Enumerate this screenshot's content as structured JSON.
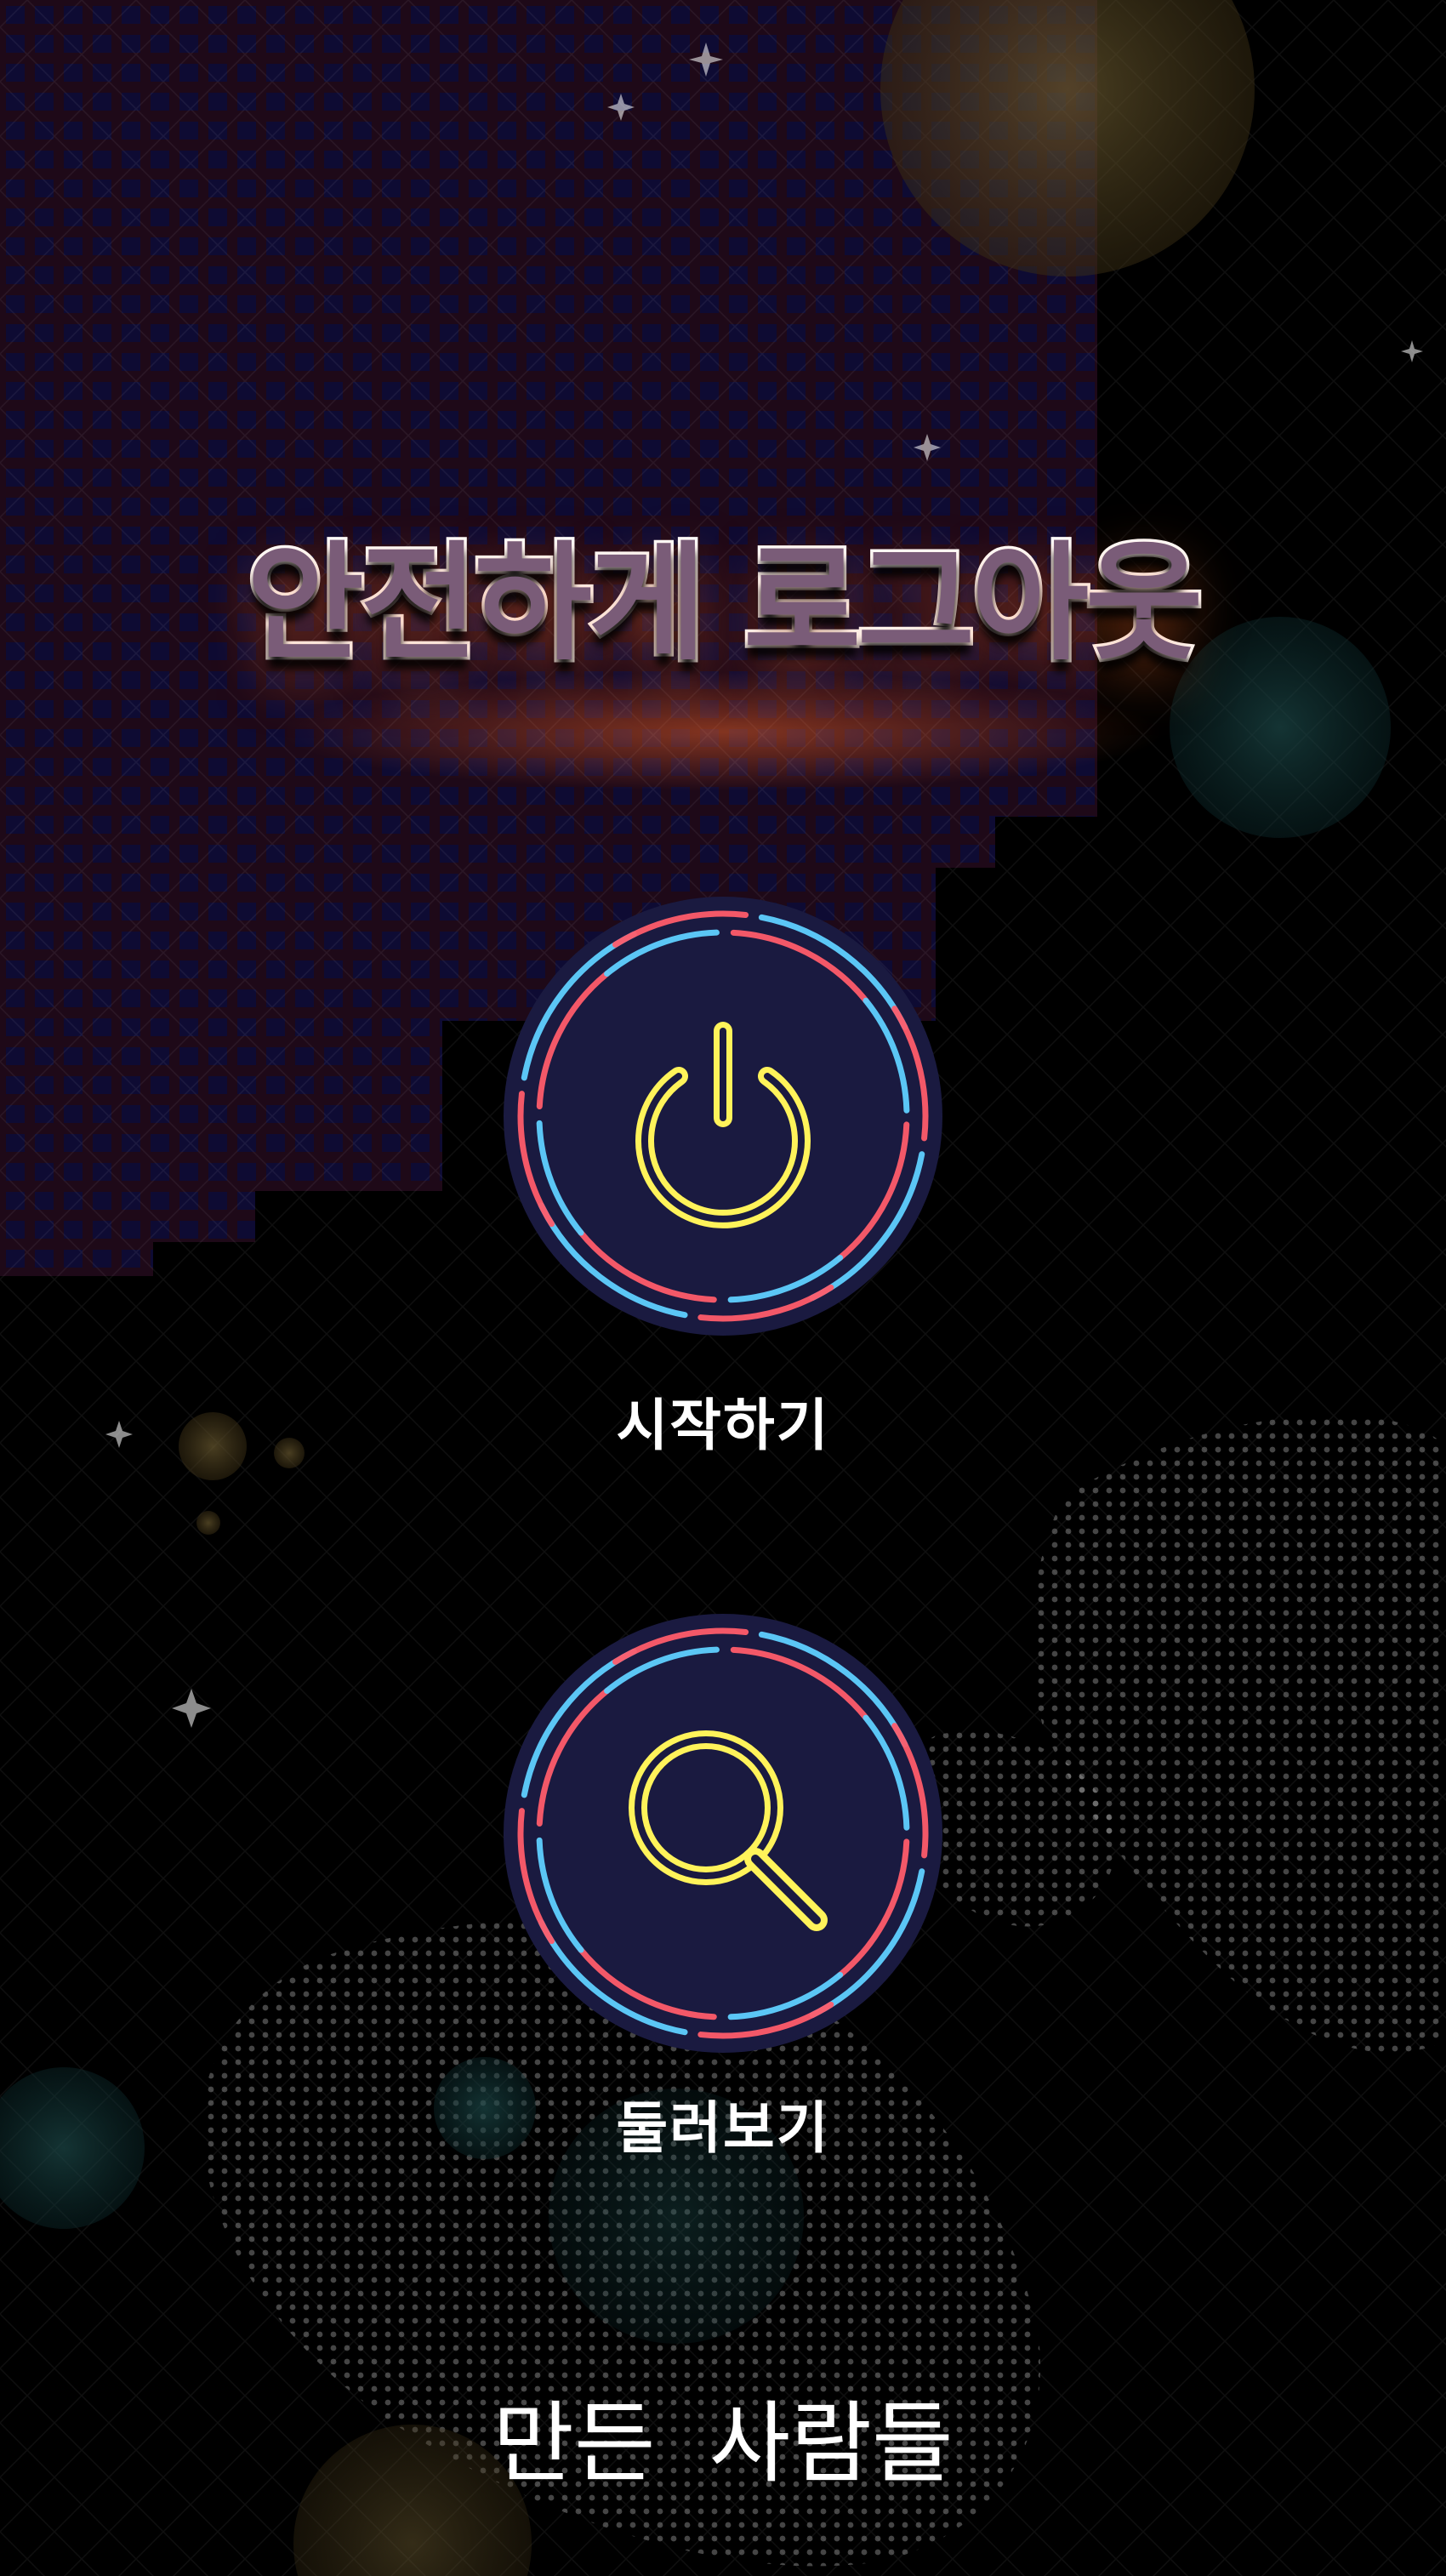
{
  "screen": {
    "title": "안전하게 로그아웃",
    "start_label": "시작하기",
    "browse_label": "둘러보기",
    "credits_label": "만든 사람들"
  },
  "icons": {
    "start": "power-icon",
    "browse": "magnifier-icon"
  },
  "colors": {
    "background": "#000000",
    "grid_panel": "#141046",
    "grid_glow": "#b0284a",
    "button_fill": "#1a1a40",
    "ring_blue": "#5fd0ff",
    "ring_red": "#ff5c6a",
    "icon_yellow": "#fff35a",
    "title_fill": "#7a5c78",
    "title_outline": "#ffffff",
    "label_text": "#ffffff"
  }
}
